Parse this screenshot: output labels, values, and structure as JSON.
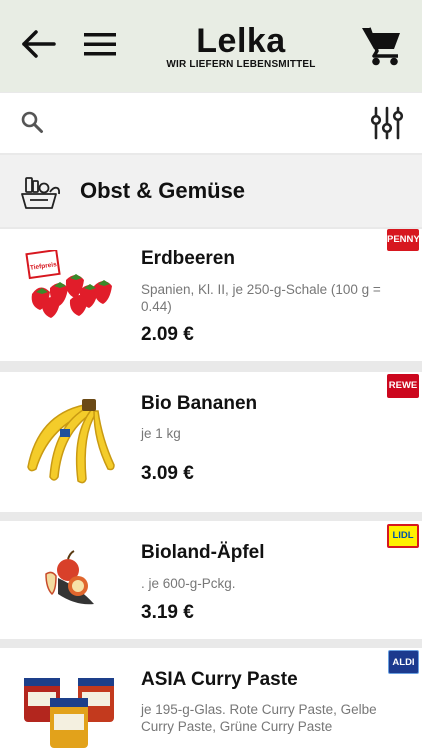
{
  "header": {
    "title": "Lelka",
    "subtitle": "WIR LIEFERN LEBENSMITTEL",
    "back_icon": "arrow-left-icon",
    "menu_icon": "menu-icon",
    "cart_icon": "cart-icon"
  },
  "search": {
    "placeholder": "",
    "value": "",
    "search_icon": "search-icon",
    "filter_icon": "filter-sliders-icon"
  },
  "category": {
    "title": "Obst & Gemüse",
    "icon": "groceries-bag-icon"
  },
  "products": [
    {
      "name": "Erdbeeren",
      "description": "Spanien, Kl. II, je 250-g-Schale (100 g = 0.44)",
      "price": "2.09 €",
      "store": "PENNY",
      "store_color": "#d7171f",
      "store_text_color": "#ffffff",
      "image": "strawberries-image",
      "sticker_text": "Tiefpreis"
    },
    {
      "name": "Bio Bananen",
      "description": "je 1 kg",
      "price": "3.09 €",
      "store": "REWE",
      "store_color": "#cc071e",
      "store_text_color": "#ffffff",
      "image": "bananas-image"
    },
    {
      "name": "Bioland-Äpfel",
      "description": ". je 600-g-Pckg.",
      "price": "3.19 €",
      "store": "LIDL",
      "store_color": "#fff000",
      "store_text_color": "#0050aa",
      "image": "apples-image"
    },
    {
      "name": "ASIA Curry Paste",
      "description": "je 195-g-Glas. Rote Curry Paste, Gelbe Curry Paste, Grüne Curry Paste",
      "price": "",
      "store": "ALDI",
      "store_color": "#1c3a8e",
      "store_text_color": "#ffffff",
      "image": "curry-paste-jars-image"
    }
  ]
}
